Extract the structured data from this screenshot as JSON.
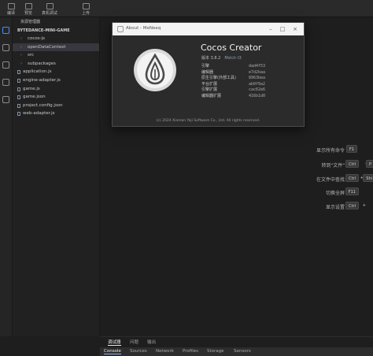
{
  "toolbar": {
    "items": [
      {
        "label": "编译"
      },
      {
        "label": "预览"
      },
      {
        "label": "真机调试"
      },
      {
        "label": "上传"
      }
    ]
  },
  "sidebar": {
    "title": "资源管理器",
    "project": "BYTEDANCE-MINI-GAME",
    "rows": [
      {
        "label": "cocos-js",
        "chevron": "›"
      },
      {
        "label": "openDataContext",
        "chevron": "›"
      },
      {
        "label": "src",
        "chevron": "›"
      },
      {
        "label": "subpackages",
        "chevron": "›"
      },
      {
        "label": "application.js"
      },
      {
        "label": "engine-adapter.js"
      },
      {
        "label": "game.js"
      },
      {
        "label": "game.json"
      },
      {
        "label": "project.config.json"
      },
      {
        "label": "web-adapter.js"
      }
    ]
  },
  "shortcuts": [
    {
      "label": "显示所有命令",
      "keys": [
        "F1"
      ]
    },
    {
      "label": "转到\"文件\"",
      "keys": [
        "Ctrl",
        "+",
        "P"
      ]
    },
    {
      "label": "在文件中查找",
      "keys": [
        "Ctrl",
        "+",
        "Shi"
      ]
    },
    {
      "label": "切换全屏",
      "keys": [
        "F11"
      ]
    },
    {
      "label": "显示设置",
      "keys": [
        "Ctrl",
        "+"
      ]
    }
  ],
  "about": {
    "window_title": "About - MeNeeq",
    "product": "Cocos Creator",
    "version_label": "版本 3.8.2",
    "version_tag": "Mstch t3",
    "info": [
      {
        "key": "引擎",
        "value": "dad4f53"
      },
      {
        "key": "编辑器",
        "value": "e7d2baa"
      },
      {
        "key": "原生引擎(外部工具)",
        "value": "8963bea"
      },
      {
        "key": "平台扩展",
        "value": "ab0f9a2"
      },
      {
        "key": "引擎扩展",
        "value": "cac62e6"
      },
      {
        "key": "编辑器扩展",
        "value": "416b1d0"
      }
    ],
    "copyright": "(c) 2024 Xiamen Yaji Software Co., Ltd. All rights reserved."
  },
  "panel": {
    "tabs": [
      "调试器",
      "问题",
      "输出"
    ],
    "devtools_tabs": [
      "Console",
      "Sources",
      "Network",
      "Profiles",
      "Storage",
      "Sensors"
    ]
  }
}
